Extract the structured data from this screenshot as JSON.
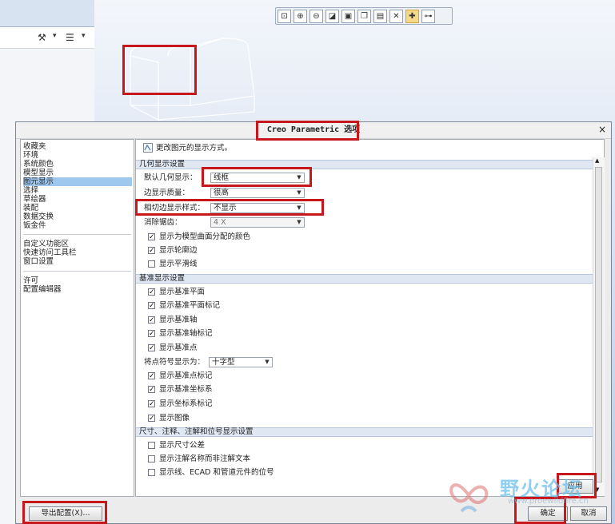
{
  "toolbar": {
    "icons": [
      "zoom-fit",
      "zoom-in",
      "zoom-out",
      "repaint",
      "display-style",
      "saved-orientations",
      "view-manager",
      "datum-display",
      "spin-center",
      "annotation-display"
    ]
  },
  "left_tools": {
    "settings_glyph": "⚒",
    "tree_glyph": "☰",
    "dropdown": "▾"
  },
  "dialog": {
    "title": "Creo Parametric 选项",
    "close": "×",
    "nav": {
      "group1": [
        "收藏夹",
        "环境",
        "系统颜色",
        "模型显示",
        "图元显示",
        "选择",
        "草绘器",
        "装配",
        "数据交换",
        "钣金件"
      ],
      "selected_index": 4,
      "group2": [
        "自定义功能区",
        "快速访问工具栏",
        "窗口设置"
      ],
      "group3": [
        "许可",
        "配置编辑器"
      ]
    },
    "header_text": "更改图元的显示方式。",
    "geometry_section": {
      "title": "几何显示设置",
      "default_display_label": "默认几何显示：",
      "default_display_value": "线框",
      "edge_quality_label": "边显示质量：",
      "edge_quality_value": "很高",
      "tangent_style_label": "相切边显示样式：",
      "tangent_style_value": "不显示",
      "antialias_label": "消除锯齿：",
      "antialias_value": "4 X",
      "checks": [
        {
          "label": "显示为模型曲面分配的颜色",
          "checked": true
        },
        {
          "label": "显示轮廓边",
          "checked": true
        },
        {
          "label": "显示平滑线",
          "checked": false
        }
      ]
    },
    "datum_section": {
      "title": "基准显示设置",
      "checks_a": [
        {
          "label": "显示基准平面",
          "checked": true
        },
        {
          "label": "显示基准平面标记",
          "checked": true
        },
        {
          "label": "显示基准轴",
          "checked": true
        },
        {
          "label": "显示基准轴标记",
          "checked": true
        },
        {
          "label": "显示基准点",
          "checked": true
        }
      ],
      "point_symbol_label": "将点符号显示为：",
      "point_symbol_value": "十字型",
      "checks_b": [
        {
          "label": "显示基准点标记",
          "checked": true
        },
        {
          "label": "显示基准坐标系",
          "checked": true
        },
        {
          "label": "显示坐标系标记",
          "checked": true
        },
        {
          "label": "显示图像",
          "checked": true
        }
      ]
    },
    "dimension_section": {
      "title": "尺寸、注释、注解和位号显示设置",
      "checks": [
        {
          "label": "显示尺寸公差",
          "checked": false
        },
        {
          "label": "显示注解名称而非注解文本",
          "checked": false
        },
        {
          "label": "显示线、ECAD 和管道元件的位号",
          "checked": false
        }
      ]
    },
    "buttons": {
      "export": "导出配置(X)...",
      "apply": "应用",
      "ok": "确定",
      "cancel": "取消"
    }
  },
  "watermark": {
    "text": "野火论坛",
    "url": "www.proewildfire.cn"
  }
}
